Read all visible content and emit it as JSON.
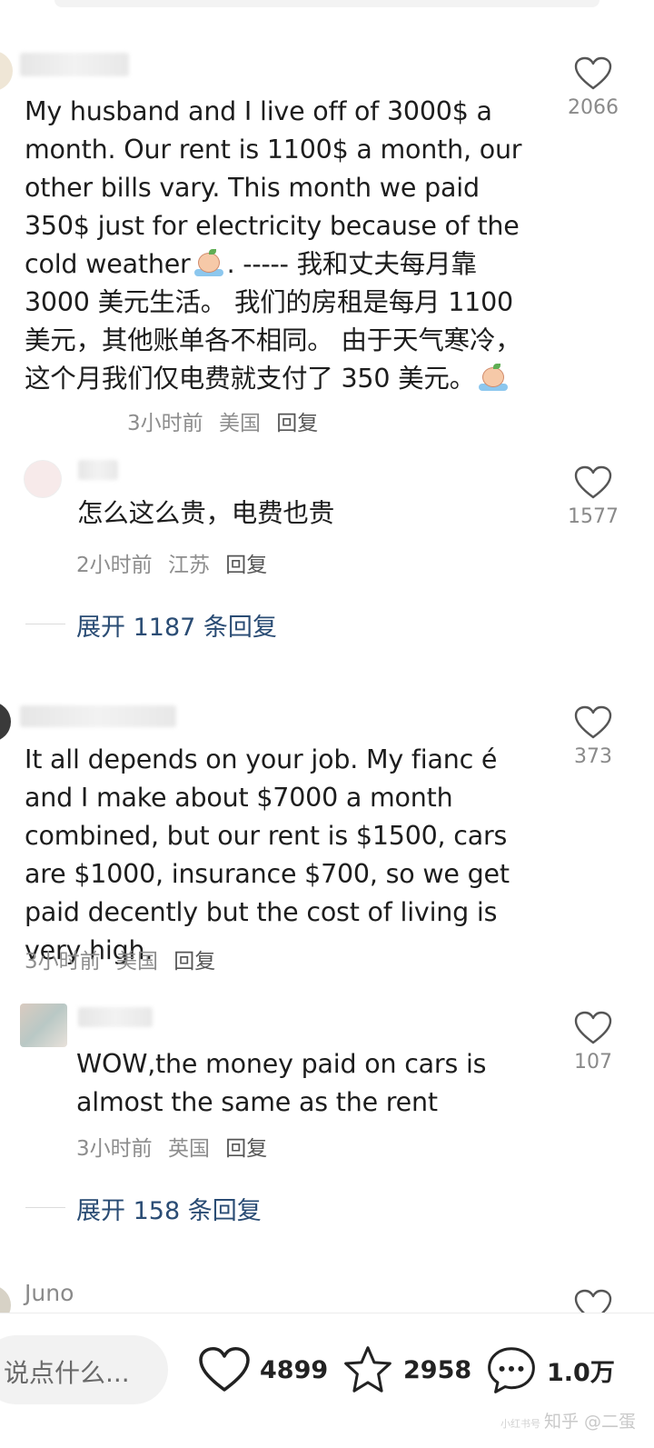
{
  "comments": [
    {
      "text_en": "My husband and I live off of 3000$ a month. Our rent is 1100$ a month, our other bills vary. This month we paid 350$ just for electricity because of the cold weather",
      "text_zh_a": ". ----- 我和丈夫每月靠 3000 美元生活。 我们的房租是每月 1100 美元，其他账单各不相同。 由于天气寒冷，这个月我们仅电费就支付了 350 美元。",
      "time": "3小时前",
      "location": "美国",
      "reply_label": "回复",
      "likes": "2066",
      "reply": {
        "text": "怎么这么贵，电费也贵",
        "time": "2小时前",
        "location": "江苏",
        "reply_label": "回复",
        "likes": "1577"
      },
      "expand_label": "展开 1187 条回复"
    },
    {
      "text": "It all depends on your job. My fianc é  and I make about $7000 a month combined, but our rent is $1500, cars are $1000, insurance $700, so we get paid decently but the cost of living is very high.",
      "time": "3小时前",
      "location": "美国",
      "reply_label": "回复",
      "likes": "373",
      "reply": {
        "text": "WOW,the money paid on cars is almost the same as the rent",
        "time": "3小时前",
        "location": "英国",
        "reply_label": "回复",
        "likes": "107"
      },
      "expand_label": "展开 158 条回复"
    },
    {
      "username": "Juno"
    }
  ],
  "bottom_bar": {
    "input_placeholder": "说点什么...",
    "likes": "4899",
    "stars": "2958",
    "comments": "1.0万"
  },
  "watermark": {
    "small": "小红书号",
    "text": "知乎 @二蛋"
  },
  "colors": {
    "link": "#2a4c74",
    "meta": "#8d8d8d",
    "icon": "#222222"
  },
  "icons": [
    "heart-icon",
    "star-icon",
    "chat-bubble-icon",
    "crying-emoji-icon"
  ]
}
